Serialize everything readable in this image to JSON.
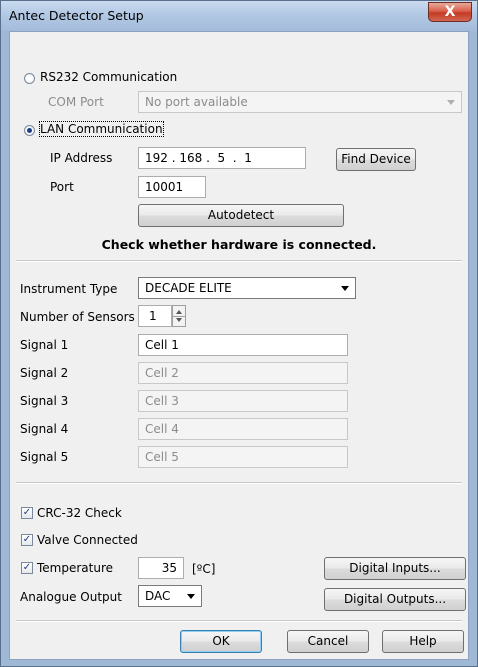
{
  "window": {
    "title": "Antec Detector Setup",
    "close_label": "X"
  },
  "comm": {
    "rs232_label": "RS232 Communication",
    "com_port_label": "COM Port",
    "com_port_value": "No port available",
    "lan_label": "LAN Communication",
    "selected": "LAN Communication",
    "ip_label": "IP Address",
    "ip_value": "192 . 168 .  5  .  1",
    "find_device_label": "Find Device",
    "port_label": "Port",
    "port_value": "10001",
    "autodetect_label": "Autodetect",
    "status_message": "Check whether hardware is connected."
  },
  "instrument": {
    "type_label": "Instrument Type",
    "type_value": "DECADE ELITE",
    "sensors_label": "Number of Sensors",
    "sensors_value": "1",
    "signals": [
      {
        "label": "Signal 1",
        "value": "Cell 1",
        "enabled": true
      },
      {
        "label": "Signal 2",
        "value": "Cell 2",
        "enabled": false
      },
      {
        "label": "Signal 3",
        "value": "Cell 3",
        "enabled": false
      },
      {
        "label": "Signal 4",
        "value": "Cell 4",
        "enabled": false
      },
      {
        "label": "Signal 5",
        "value": "Cell 5",
        "enabled": false
      }
    ]
  },
  "options": {
    "crc_label": "CRC-32 Check",
    "crc_checked": true,
    "valve_label": "Valve Connected",
    "valve_checked": true,
    "temperature_label": "Temperature",
    "temperature_checked": true,
    "temperature_value": "35",
    "temperature_unit": "[ºC]",
    "digital_inputs_label": "Digital Inputs...",
    "analogue_label": "Analogue Output",
    "analogue_value": "DAC",
    "digital_outputs_label": "Digital Outputs..."
  },
  "footer": {
    "ok_label": "OK",
    "cancel_label": "Cancel",
    "help_label": "Help"
  },
  "icons": {
    "check_glyph": "✓"
  },
  "colors": {
    "titlebar": "#b2c8e3",
    "close_button": "#c43a24",
    "dialog_background": "#f0f0f0",
    "default_button_border": "#3c7fb1"
  }
}
